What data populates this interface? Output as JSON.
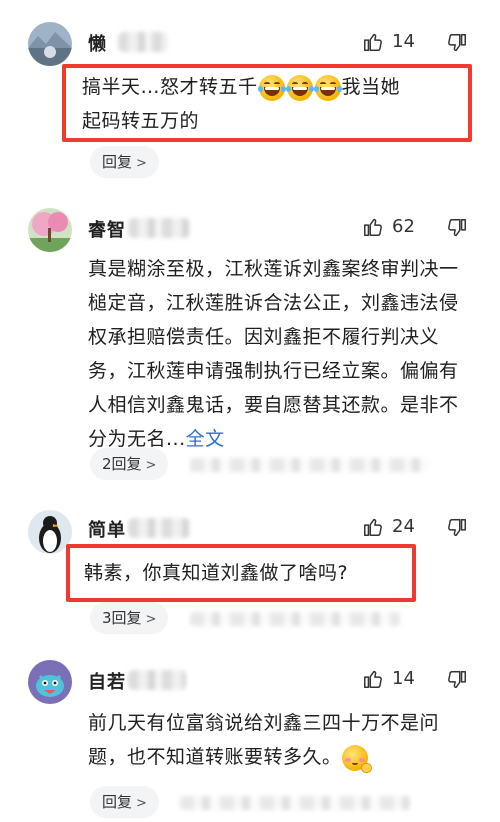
{
  "comments": [
    {
      "username": "懒",
      "like_count": "14",
      "text_lines": [
        "搞半天…怒才转五千",
        "我当她",
        "起码转五万的"
      ],
      "reply_label": "回复"
    },
    {
      "username": "睿智",
      "like_count": "62",
      "text": "真是糊涂至极，江秋莲诉刘鑫案终审判决一槌定音，江秋莲胜诉合法公正，刘鑫违法侵权承担赔偿责任。因刘鑫拒不履行判决义务，江秋莲申请强制执行已经立案。偏偏有人相信刘鑫鬼话，要自愿替其还款。是非不分为无名...",
      "fulltext_link": "全文",
      "reply_label": "2回复"
    },
    {
      "username": "简单",
      "like_count": "24",
      "text": "韩素，你真知道刘鑫做了啥吗?",
      "reply_label": "3回复"
    },
    {
      "username": "自若",
      "like_count": "14",
      "text": "前几天有位富翁说给刘鑫三四十万不是问题，也不知道转账要转多久。",
      "reply_label": "回复"
    }
  ],
  "icons": {
    "like": "thumbs-up-icon",
    "dislike": "thumbs-down-icon",
    "reply_chevron": "chevron-right-icon"
  },
  "colors": {
    "highlight": "#ee3a2f",
    "link": "#2b6fd6",
    "pill_bg": "#f3f4f6"
  }
}
